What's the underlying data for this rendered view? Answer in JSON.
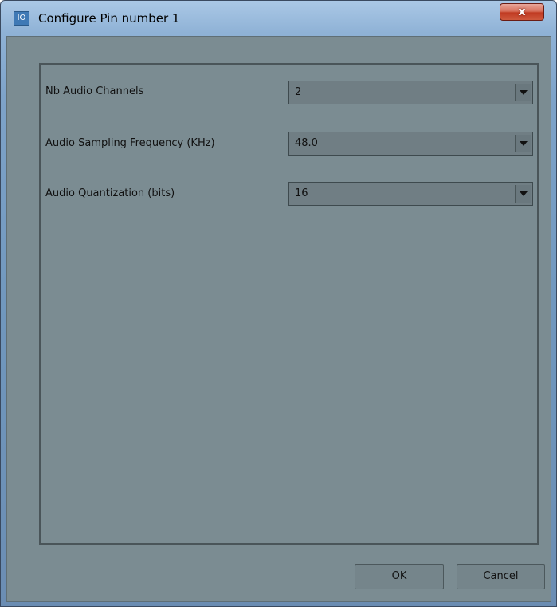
{
  "window": {
    "title": "Configure Pin number 1",
    "icon": "app-icon",
    "icon_glyph": "IO",
    "close_label": "x"
  },
  "form": {
    "rows": [
      {
        "label": "Nb Audio Channels",
        "value": "2"
      },
      {
        "label": "Audio Sampling Frequency (KHz)",
        "value": "48.0"
      },
      {
        "label": "Audio Quantization (bits)",
        "value": "16"
      }
    ]
  },
  "buttons": {
    "ok_label": "OK",
    "cancel_label": "Cancel"
  },
  "colors": {
    "client_background": "#7b8c92",
    "frame_gradient_top": "#aac8e6",
    "close_button": "#c03a22"
  }
}
